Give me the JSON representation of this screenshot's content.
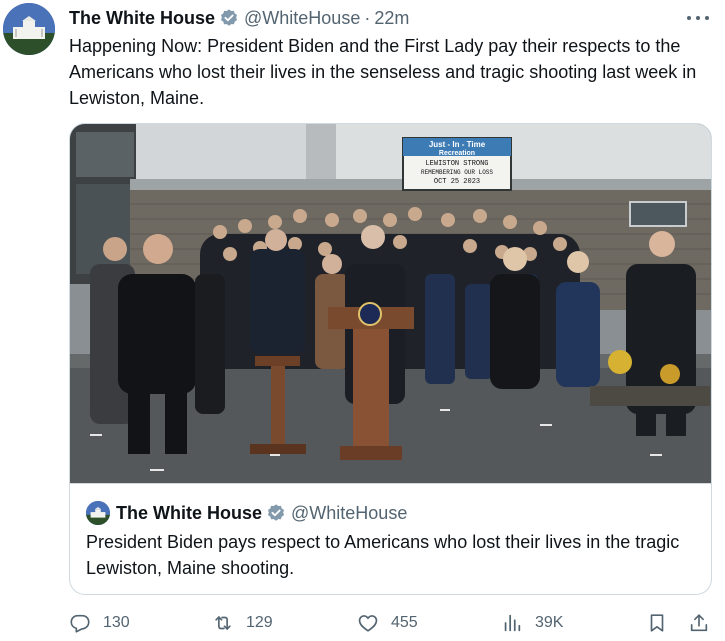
{
  "tweet": {
    "display_name": "The White House",
    "handle": "@WhiteHouse",
    "separator": "·",
    "time": "22m",
    "text": "Happening Now: President Biden and the First Lady pay their respects to the Americans who lost their lives in the senseless and tragic shooting last week in Lewiston, Maine."
  },
  "media": {
    "sign_lines": [
      "Just - In - Time",
      "Recreation",
      "LEWISTON STRONG",
      "REMEMBERING OUR LOSS",
      "OCT 25 2023"
    ]
  },
  "quoted_tweet": {
    "display_name": "The White House",
    "handle": "@WhiteHouse",
    "text": "President Biden pays respect to Americans who lost their lives in the tragic Lewiston, Maine shooting."
  },
  "actions": {
    "replies": "130",
    "reposts": "129",
    "likes": "455",
    "views": "39K"
  },
  "colors": {
    "verified_badge": "#829aab",
    "secondary_text": "#536471",
    "border": "#cfd9de"
  },
  "icons": [
    "verified-badge-icon",
    "more-options-icon",
    "reply-icon",
    "repost-icon",
    "like-icon",
    "views-icon",
    "bookmark-icon",
    "share-icon"
  ]
}
